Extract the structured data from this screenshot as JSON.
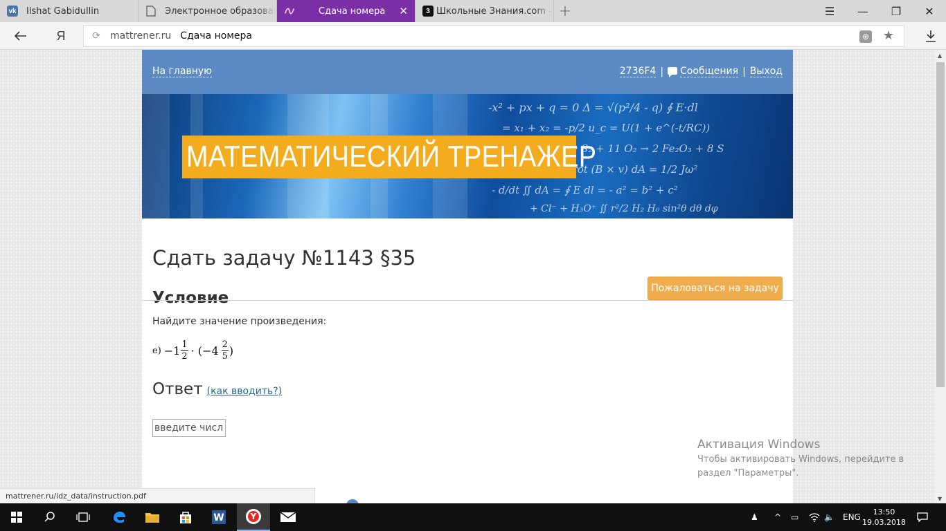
{
  "browser": {
    "tabs": [
      {
        "title": "Ilshat Gabidullin",
        "favicon": "vk-icon",
        "color": "#4a76a8",
        "glyph": "vk",
        "active": false
      },
      {
        "title": "Электронное образование",
        "favicon": "page-icon",
        "color": "#ffffff",
        "glyph": "",
        "active": false
      },
      {
        "title": "Сдача номера",
        "favicon": "mattrener-icon",
        "color": "#7b2fa6",
        "glyph": "",
        "active": true
      },
      {
        "title": "Школьные Знания.com - Ре",
        "favicon": "znanija-icon",
        "color": "#111111",
        "glyph": "3",
        "active": false
      }
    ],
    "new_tab_glyph": "+",
    "address": {
      "domain": "mattrener.ru",
      "page_title": "Сдача номера"
    },
    "status_url": "mattrener.ru/idz_data/instruction.pdf"
  },
  "site": {
    "nav_home": "На главную",
    "user_id": "2736F4",
    "separator": "|",
    "messages": "Сообщения",
    "logout": "Выход",
    "banner_title": "МАТЕМАТИЧЕСКИЙ ТРЕНАЖЕР"
  },
  "task": {
    "title": "Сдать задачу №1143 §35",
    "report_button": "Пожаловаться на задачу",
    "condition_heading": "Условие",
    "condition_text": "Найдите значение произведения:",
    "expression": {
      "label": "е)",
      "part1_sign": "−1",
      "frac1_num": "1",
      "frac1_den": "2",
      "middle": "· (−4",
      "frac2_num": "2",
      "frac2_den": "5",
      "close": ")"
    },
    "answer_heading": "Ответ",
    "answer_help_link": "(как вводить?)",
    "answer_placeholder": "введите число"
  },
  "watermark": {
    "title": "Активация Windows",
    "line1": "Чтобы активировать Windows, перейдите в",
    "line2": "раздел \"Параметры\"."
  },
  "taskbar": {
    "language": "ENG",
    "time": "13:50",
    "date": "19.03.2018"
  }
}
